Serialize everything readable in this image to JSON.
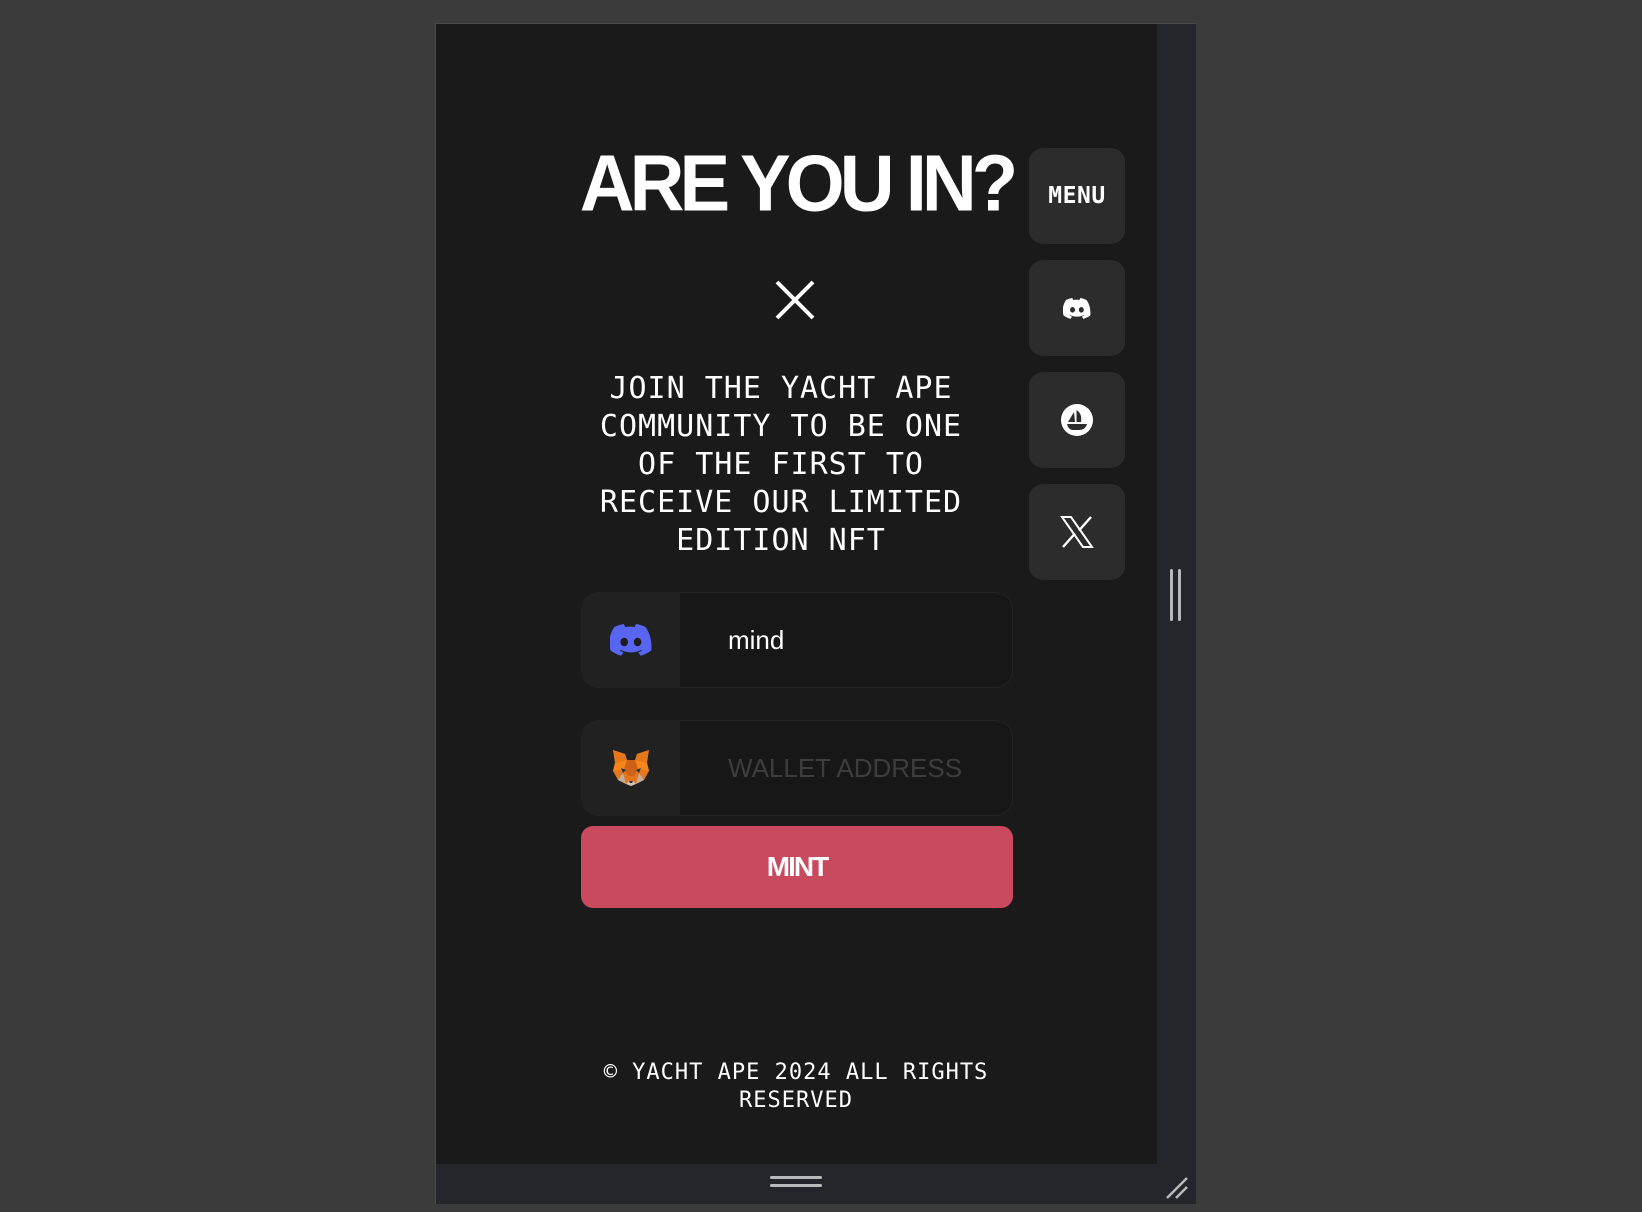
{
  "page": {
    "title": "ARE YOU IN?",
    "tagline": "JOIN THE YACHT APE COMMUNITY TO BE ONE OF THE FIRST TO RECEIVE OUR LIMITED EDITION NFT",
    "footer": "© YACHT APE 2024 ALL RIGHTS RESERVED"
  },
  "form": {
    "discord_value": "mind",
    "wallet_value": "",
    "wallet_placeholder": "WALLET ADDRESS",
    "mint_label": "MINT"
  },
  "side_nav": {
    "menu_label": "MENU",
    "icons": [
      "discord-icon",
      "opensea-icon",
      "x-icon"
    ]
  },
  "colors": {
    "background": "#1a1a1a",
    "mint_button": "#c9495e",
    "discord_brand": "#5865f2",
    "side_button": "#2c2c2c"
  }
}
